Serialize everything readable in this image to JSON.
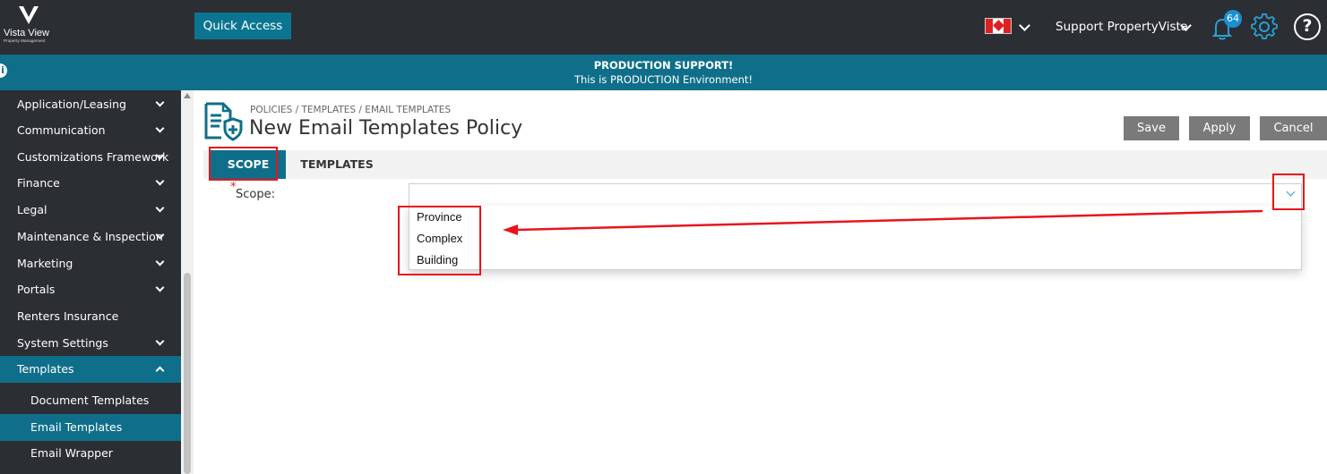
{
  "header": {
    "logo_title": "Vista View",
    "logo_subtitle": "Property Management",
    "quick_access_label": "Quick Access",
    "user_name": "Support PropertyVista",
    "notification_count": "64",
    "help_symbol": "?",
    "flag": "canada-flag-icon"
  },
  "banner": {
    "title": "PRODUCTION SUPPORT!",
    "subtitle": "This is PRODUCTION Environment!",
    "info_symbol": "i"
  },
  "sidebar": {
    "items": [
      {
        "label": "Application/Leasing",
        "expandable": true
      },
      {
        "label": "Communication",
        "expandable": true
      },
      {
        "label": "Customizations Framework",
        "expandable": true
      },
      {
        "label": "Finance",
        "expandable": true
      },
      {
        "label": "Legal",
        "expandable": true
      },
      {
        "label": "Maintenance & Inspection",
        "expandable": true
      },
      {
        "label": "Marketing",
        "expandable": true
      },
      {
        "label": "Portals",
        "expandable": true
      },
      {
        "label": "Renters Insurance",
        "expandable": false
      },
      {
        "label": "System Settings",
        "expandable": true
      },
      {
        "label": "Templates",
        "expandable": true,
        "expanded": true,
        "active": true
      }
    ],
    "sub_items": [
      {
        "label": "Document Templates"
      },
      {
        "label": "Email Templates",
        "active": true
      },
      {
        "label": "Email Wrapper"
      }
    ]
  },
  "page": {
    "breadcrumb": "POLICIES / TEMPLATES / EMAIL TEMPLATES",
    "title": "New Email Templates Policy",
    "buttons": {
      "save": "Save",
      "apply": "Apply",
      "cancel": "Cancel"
    },
    "tabs": [
      {
        "label": "SCOPE",
        "active": true
      },
      {
        "label": "TEMPLATES",
        "active": false
      }
    ],
    "scope": {
      "required_mark": "*",
      "label": "Scope:",
      "value": "",
      "options": [
        "Province",
        "Complex",
        "Building"
      ]
    }
  },
  "colors": {
    "topbar": "#2b2e33",
    "accent": "#0f6f8a",
    "button_gray": "#7a7a7a",
    "annotation_red": "#e8141e"
  }
}
